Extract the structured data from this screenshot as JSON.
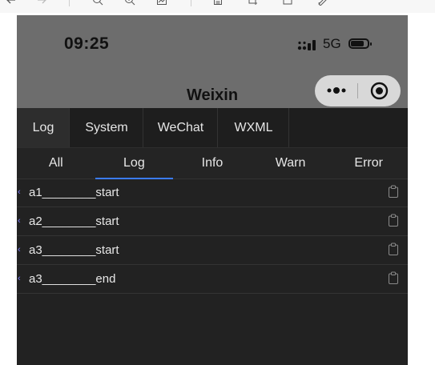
{
  "app": {
    "time": "09:25",
    "network": "5G",
    "title": "Weixin"
  },
  "main_tabs": [
    {
      "label": "Log",
      "active": true
    },
    {
      "label": "System",
      "active": false
    },
    {
      "label": "WeChat",
      "active": false
    },
    {
      "label": "WXML",
      "active": false
    }
  ],
  "level_tabs": [
    {
      "label": "All",
      "active": false
    },
    {
      "label": "Log",
      "active": true
    },
    {
      "label": "Info",
      "active": false
    },
    {
      "label": "Warn",
      "active": false
    },
    {
      "label": "Error",
      "active": false
    }
  ],
  "logs": [
    {
      "text": "a1________start"
    },
    {
      "text": "a2________start"
    },
    {
      "text": "a3________start"
    },
    {
      "text": "a3________end"
    }
  ],
  "icons": {
    "toolbar": [
      "arrow-left-icon",
      "arrow-right-icon",
      "zoom-out-icon",
      "zoom-in-icon",
      "image-icon",
      "document-icon",
      "crop-icon",
      "box-icon",
      "pen-icon"
    ],
    "capsule": [
      "more-dots-icon",
      "close-target-icon"
    ],
    "log_row": [
      "expand-caret-icon",
      "copy-icon"
    ]
  },
  "colors": {
    "tab_underline": "#3b7cff",
    "caret": "#7b7bff",
    "statusbar": "#6d6d6d",
    "panel": "#222222"
  }
}
